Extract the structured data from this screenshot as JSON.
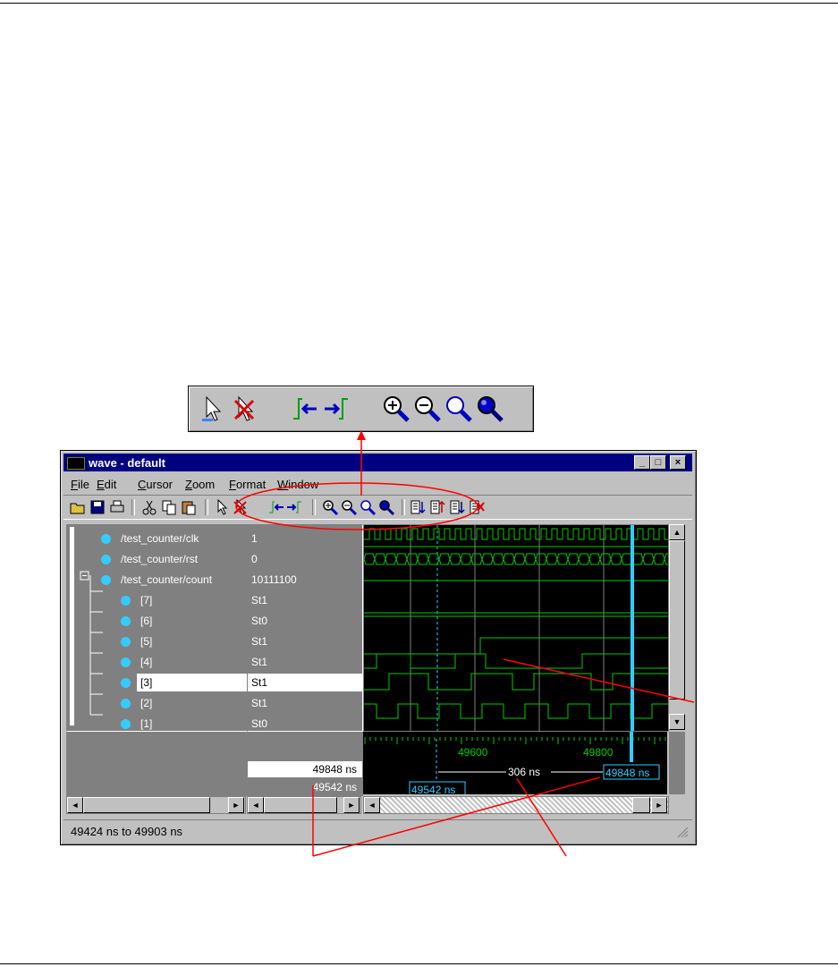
{
  "window": {
    "title": "wave - default",
    "min": "_",
    "max": "□",
    "close": "×"
  },
  "menu": [
    "File",
    "Edit",
    "Cursor",
    "Zoom",
    "Format",
    "Window"
  ],
  "menu_mnemonics": [
    "F",
    "E",
    "C",
    "Z",
    "F",
    "W"
  ],
  "signals": [
    {
      "name": "/test_counter/clk",
      "value": "1"
    },
    {
      "name": "/test_counter/rst",
      "value": "0"
    },
    {
      "name": "/test_counter/count",
      "value": "10111100"
    },
    {
      "name": "[7]",
      "value": "St1"
    },
    {
      "name": "[6]",
      "value": "St0"
    },
    {
      "name": "[5]",
      "value": "St1"
    },
    {
      "name": "[4]",
      "value": "St1"
    },
    {
      "name": "[3]",
      "value": "St1"
    },
    {
      "name": "[2]",
      "value": "St1"
    },
    {
      "name": "[1]",
      "value": "St0"
    }
  ],
  "expand_glyph": "⊟",
  "timeline": {
    "labels": [
      "49600",
      "49800"
    ]
  },
  "cursors": {
    "active": "49848 ns",
    "reference": "49542 ns",
    "delta": "306 ns"
  },
  "status": "49424 ns to 49903 ns",
  "colors": {
    "wave": "#00cc00",
    "cursor_active": "#33ccff",
    "callout": "#ff0000",
    "titlebar": "#000080"
  }
}
